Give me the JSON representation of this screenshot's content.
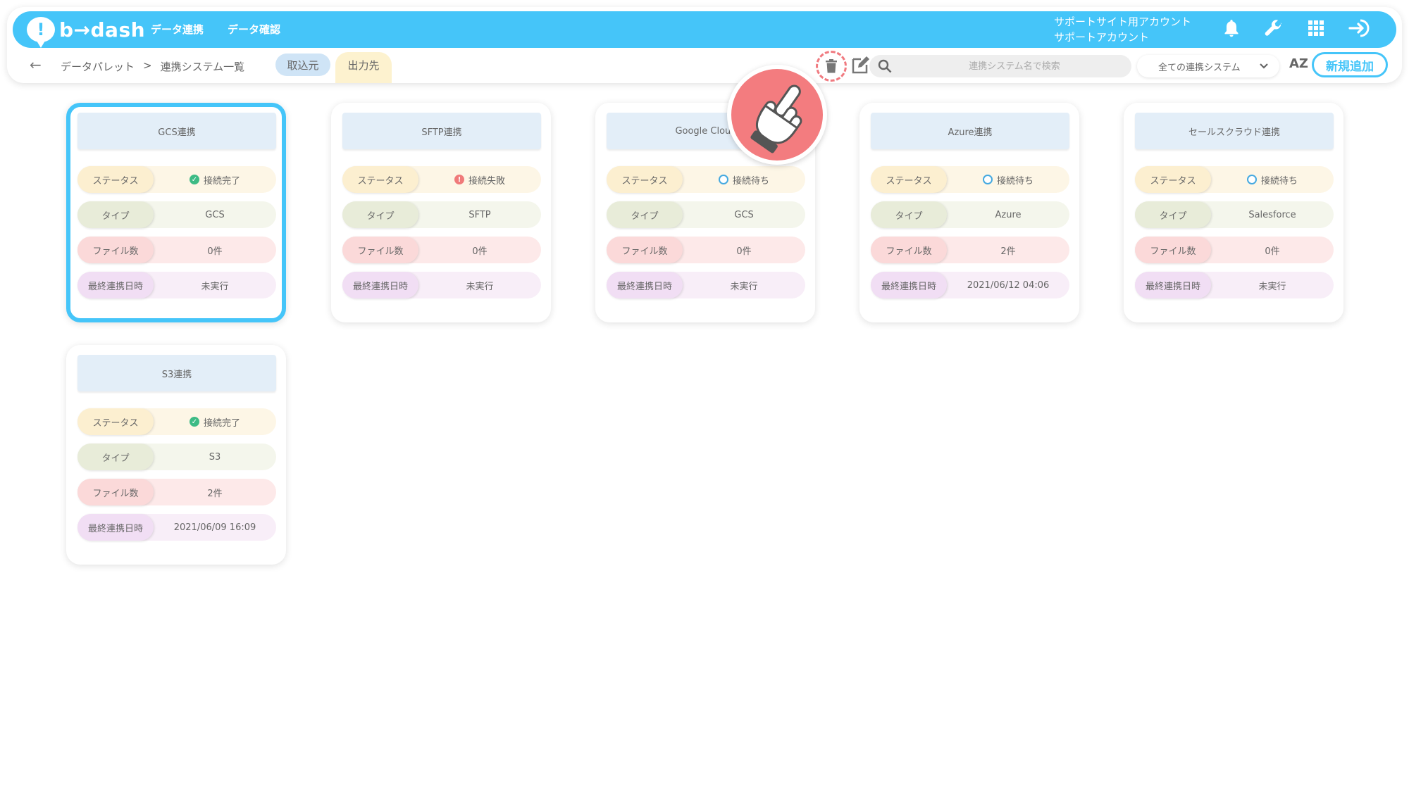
{
  "app": {
    "brand": "b→dash",
    "nav": [
      "データ連携",
      "データ確認"
    ],
    "account_line1": "サポートサイト用アカウント",
    "account_line2": "サポートアカウント"
  },
  "icons": {
    "bell": "bell-icon",
    "wrench": "wrench-icon",
    "grid": "apps-grid-icon",
    "logout": "logout-icon",
    "trash": "trash-icon",
    "edit": "edit-icon",
    "search": "search-icon",
    "hand": "pointing-hand-icon"
  },
  "colors": {
    "accent": "#45c5f9",
    "ok": "#3dbb85",
    "error": "#f07a7a",
    "pointer": "#f37c7f"
  },
  "subbar": {
    "back": "←",
    "breadcrumb_root": "データパレット",
    "breadcrumb_sep": ">",
    "breadcrumb_current": "連携システム一覧",
    "tab_import": "取込元",
    "tab_export": "出力先",
    "search_placeholder": "連携システム名で検索",
    "filter_value": "全ての連携システム",
    "sort_label": "AZ",
    "new_button": "新規追加"
  },
  "labels": {
    "status": "ステータス",
    "type": "タイプ",
    "files": "ファイル数",
    "last": "最終連携日時"
  },
  "cards": [
    {
      "title": "GCS連携",
      "status": "接続完了",
      "status_kind": "ok",
      "type": "GCS",
      "files": "0件",
      "last": "未実行"
    },
    {
      "title": "SFTP連携",
      "status": "接続失敗",
      "status_kind": "err",
      "type": "SFTP",
      "files": "0件",
      "last": "未実行"
    },
    {
      "title": "Google Cloud",
      "status": "接続待ち",
      "status_kind": "wait",
      "type": "GCS",
      "files": "0件",
      "last": "未実行"
    },
    {
      "title": "Azure連携",
      "status": "接続待ち",
      "status_kind": "wait",
      "type": "Azure",
      "files": "2件",
      "last": "2021/06/12 04:06"
    },
    {
      "title": "セールスクラウド連携",
      "status": "接続待ち",
      "status_kind": "wait",
      "type": "Salesforce",
      "files": "0件",
      "last": "未実行"
    },
    {
      "title": "S3連携",
      "status": "接続完了",
      "status_kind": "ok",
      "type": "S3",
      "files": "2件",
      "last": "2021/06/09 16:09"
    }
  ]
}
